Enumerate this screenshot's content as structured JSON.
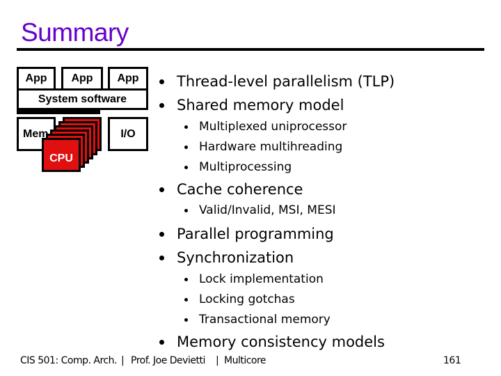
{
  "slide": {
    "title": "Summary",
    "title_color": "#6600cc"
  },
  "diagram": {
    "apps": [
      "App",
      "App",
      "App"
    ],
    "system_software": "System software",
    "memory": "Mem",
    "io": "I/O",
    "cpu": "CPU",
    "cpu_color": "#e01010"
  },
  "bullets": [
    {
      "level": 1,
      "text": "Thread-level parallelism (TLP)"
    },
    {
      "level": 1,
      "text": "Shared memory model"
    },
    {
      "level": 2,
      "text": "Multiplexed uniprocessor"
    },
    {
      "level": 2,
      "text": "Hardware multihreading"
    },
    {
      "level": 2,
      "text": "Multiprocessing"
    },
    {
      "level": 1,
      "text": "Cache coherence"
    },
    {
      "level": 2,
      "text": "Valid/Invalid, MSI, MESI"
    },
    {
      "level": 1,
      "text": "Parallel programming"
    },
    {
      "level": 1,
      "text": "Synchronization"
    },
    {
      "level": 2,
      "text": "Lock implementation"
    },
    {
      "level": 2,
      "text": "Locking gotchas"
    },
    {
      "level": 2,
      "text": "Transactional memory"
    },
    {
      "level": 1,
      "text": "Memory consistency models"
    }
  ],
  "footer": {
    "course": "CIS 501: Comp. Arch.",
    "separator": "|",
    "instructor": "Prof. Joe Devietti",
    "topic": "Multicore",
    "page_number": "161"
  }
}
